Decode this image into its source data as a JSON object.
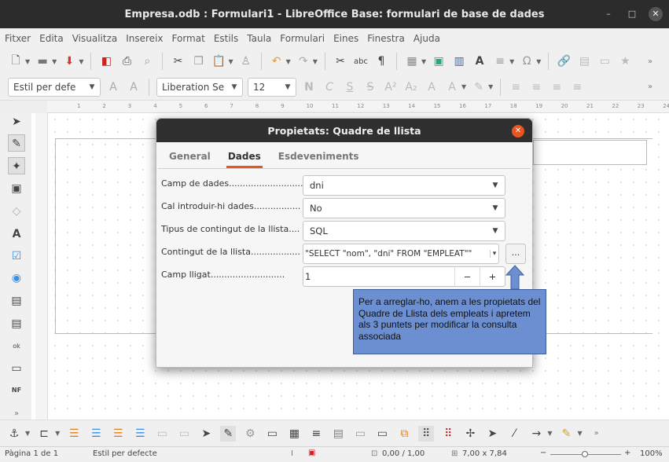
{
  "window": {
    "title": "Empresa.odb : Formulari1 - LibreOffice Base: formulari de base de dades"
  },
  "menu": [
    "Fitxer",
    "Edita",
    "Visualitza",
    "Insereix",
    "Format",
    "Estils",
    "Taula",
    "Formulari",
    "Eines",
    "Finestra",
    "Ajuda"
  ],
  "toolbar2": {
    "para_style": "Estil per defe",
    "font_name": "Liberation Se",
    "font_size": "12"
  },
  "ruler": [
    "1",
    "2",
    "3",
    "4",
    "5",
    "6",
    "7",
    "8",
    "9",
    "10",
    "11",
    "12",
    "13",
    "14",
    "15",
    "16",
    "17",
    "18",
    "19",
    "20",
    "21",
    "22",
    "23",
    "24"
  ],
  "dialog": {
    "title": "Propietats: Quadre de llista",
    "tabs": [
      "General",
      "Dades",
      "Esdeveniments"
    ],
    "active_tab": "Dades",
    "fields": [
      {
        "label": "Camp de dades............................",
        "value": "dni"
      },
      {
        "label": "Cal introduir-hi dades.................",
        "value": "No"
      },
      {
        "label": "Tipus de contingut de la llista....",
        "value": "SQL"
      },
      {
        "label": "Contingut de la llista..................",
        "value": "\"SELECT \"nom\", \"dni\" FROM \"EMPLEAT\"\""
      },
      {
        "label": "Camp lligat...........................",
        "value": "1"
      }
    ],
    "dots_button": "...",
    "minus": "−",
    "plus": "+"
  },
  "note": {
    "text": "Per a arreglar-ho, anem a les propietats del Quadre de Llista dels empleats i apretem als 3 puntets per modificar la consulta associada"
  },
  "status": {
    "page": "Pàgina 1 de 1",
    "style": "Estil per defecte",
    "position": "0,00 / 1,00",
    "size": "7,00 x 7,84",
    "zoom_minus": "−",
    "zoom_plus": "+",
    "zoom": "100%"
  },
  "colors": {
    "accent": "#e95420",
    "note_bg": "#6b8fd0",
    "titlebar": "#2c2c2c"
  }
}
